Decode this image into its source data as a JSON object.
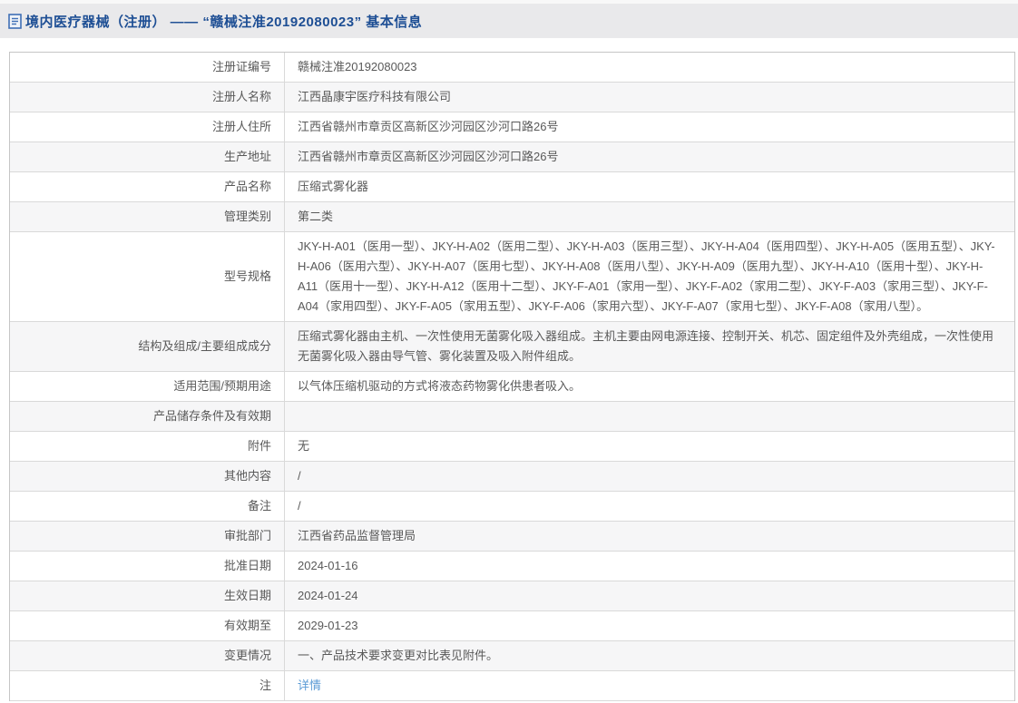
{
  "header": {
    "title": "境内医疗器械（注册） —— “赣械注准20192080023” 基本信息",
    "icon": "document-icon"
  },
  "colors": {
    "header_bar_bg": "#e9e9eb",
    "header_title": "#1d4e94",
    "zebra_row_bg": "#f6f6f7",
    "table_border": "#c6c6c6",
    "cell_text": "#595959",
    "link": "#5b9bd5"
  },
  "table": {
    "rows": [
      {
        "label": "注册证编号",
        "value": "赣械注准20192080023"
      },
      {
        "label": "注册人名称",
        "value": "江西晶康宇医疗科技有限公司"
      },
      {
        "label": "注册人住所",
        "value": "江西省赣州市章贡区高新区沙河园区沙河口路26号"
      },
      {
        "label": "生产地址",
        "value": "江西省赣州市章贡区高新区沙河园区沙河口路26号"
      },
      {
        "label": "产品名称",
        "value": "压缩式雾化器"
      },
      {
        "label": "管理类别",
        "value": "第二类"
      },
      {
        "label": "型号规格",
        "value": "JKY-H-A01（医用一型）、JKY-H-A02（医用二型）、JKY-H-A03（医用三型）、JKY-H-A04（医用四型）、JKY-H-A05（医用五型）、JKY-H-A06（医用六型）、JKY-H-A07（医用七型）、JKY-H-A08（医用八型）、JKY-H-A09（医用九型）、JKY-H-A10（医用十型）、JKY-H-A11（医用十一型）、JKY-H-A12（医用十二型）、JKY-F-A01（家用一型）、JKY-F-A02（家用二型）、JKY-F-A03（家用三型）、JKY-F-A04（家用四型）、JKY-F-A05（家用五型）、JKY-F-A06（家用六型）、JKY-F-A07（家用七型）、JKY-F-A08（家用八型）。"
      },
      {
        "label": "结构及组成/主要组成成分",
        "value": "压缩式雾化器由主机、一次性使用无菌雾化吸入器组成。主机主要由网电源连接、控制开关、机芯、固定组件及外壳组成，一次性使用无菌雾化吸入器由导气管、雾化装置及吸入附件组成。"
      },
      {
        "label": "适用范围/预期用途",
        "value": "以气体压缩机驱动的方式将液态药物雾化供患者吸入。"
      },
      {
        "label": "产品储存条件及有效期",
        "value": ""
      },
      {
        "label": "附件",
        "value": "无"
      },
      {
        "label": "其他内容",
        "value": "/"
      },
      {
        "label": "备注",
        "value": "/"
      },
      {
        "label": "审批部门",
        "value": "江西省药品监督管理局"
      },
      {
        "label": "批准日期",
        "value": "2024-01-16"
      },
      {
        "label": "生效日期",
        "value": "2024-01-24"
      },
      {
        "label": "有效期至",
        "value": "2029-01-23"
      },
      {
        "label": "变更情况",
        "value": "一、产品技术要求变更对比表见附件。"
      },
      {
        "label": "注",
        "value": "详情",
        "link": true,
        "label_icon": "note-icon"
      }
    ]
  }
}
